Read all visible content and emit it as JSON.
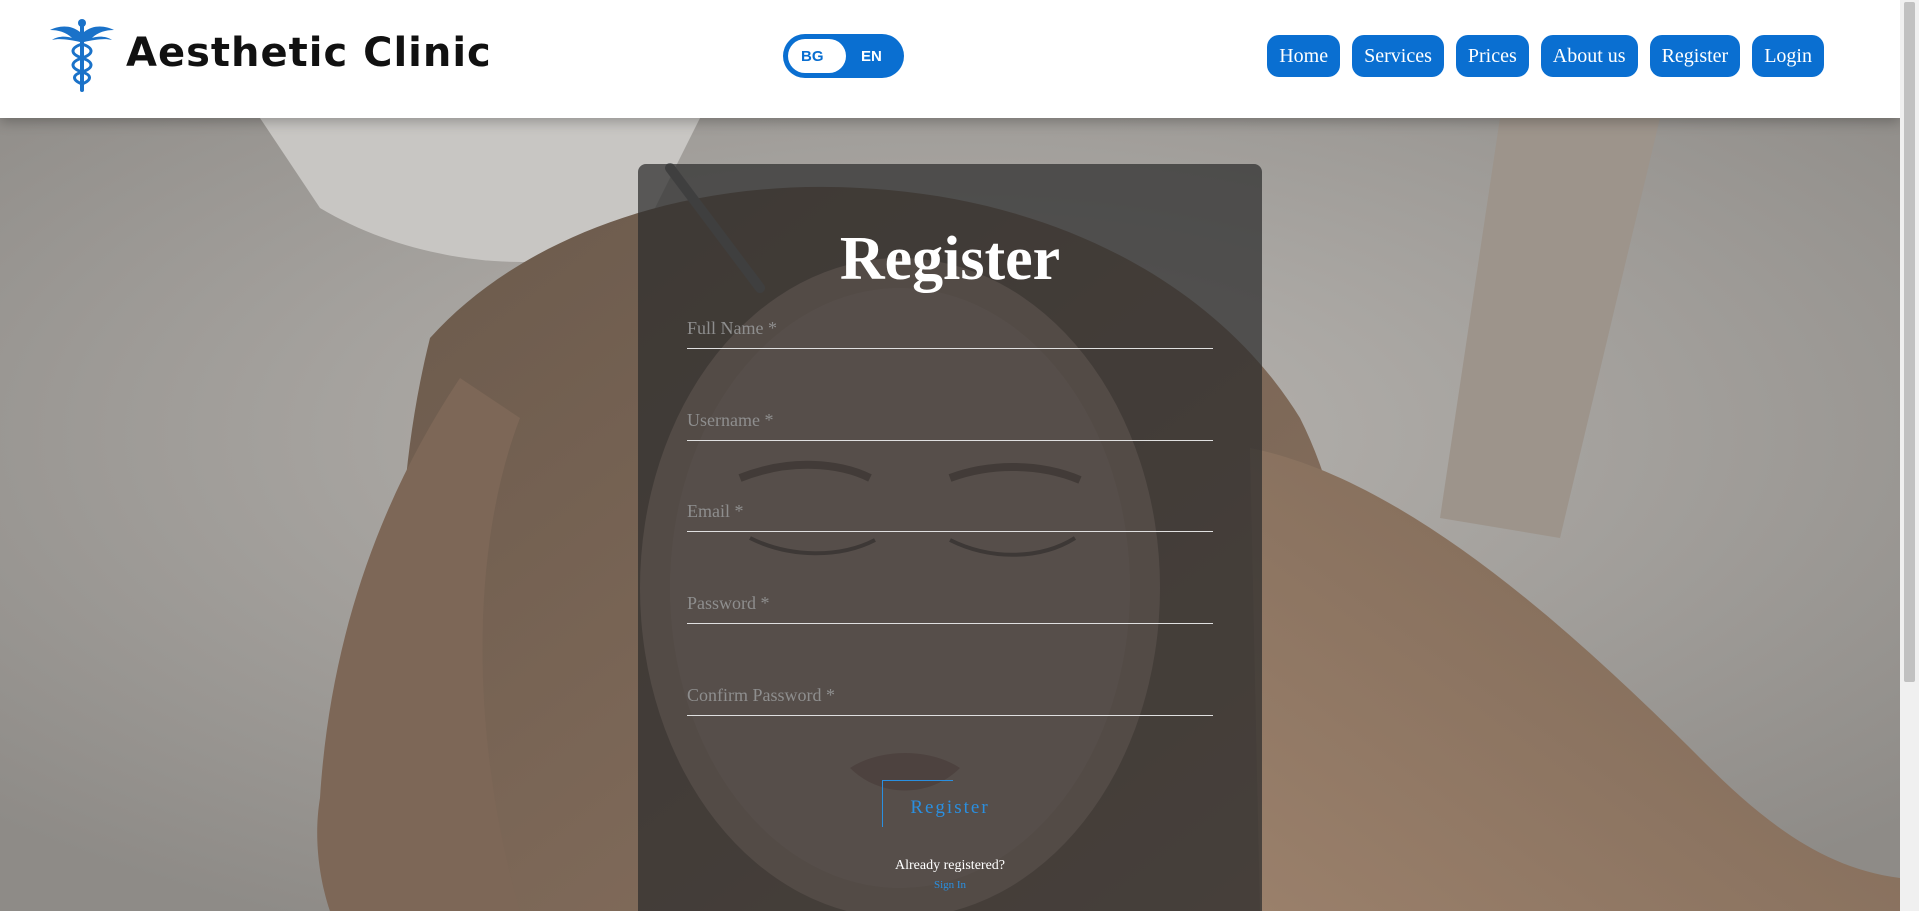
{
  "header": {
    "brand": "Aesthetic Clinic",
    "lang": {
      "bg": "BG",
      "en": "EN"
    },
    "nav": [
      "Home",
      "Services",
      "Prices",
      "About us",
      "Register",
      "Login"
    ]
  },
  "form": {
    "title": "Register",
    "fields": [
      {
        "placeholder": "Full Name *"
      },
      {
        "placeholder": "Username *"
      },
      {
        "placeholder": "Email *"
      },
      {
        "placeholder": "Password *"
      },
      {
        "placeholder": "Confirm Password *"
      }
    ],
    "submit": "Register",
    "already": "Already registered?",
    "signin": "Sign In"
  },
  "colors": {
    "accent": "#0a6fd1",
    "link": "#2a8fe0"
  }
}
